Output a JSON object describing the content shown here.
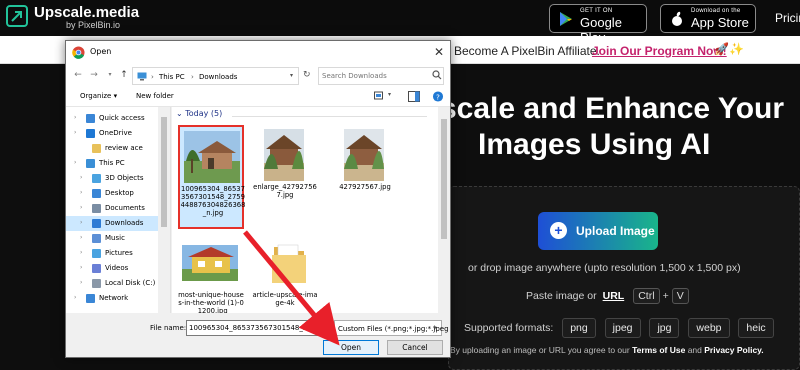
{
  "site": {
    "logo": {
      "title": "Upscale.media",
      "subtitle": "by PixelBin.io"
    },
    "stores": [
      {
        "small": "GET IT ON",
        "big": "Google Play",
        "icon": "google-play-icon"
      },
      {
        "small": "Download on the",
        "big": "App Store",
        "icon": "apple-icon"
      }
    ],
    "nav_pricing": "Pricin",
    "affiliate": {
      "text": "Become A PixelBin Affiliate.",
      "link": "Join Our Program Now!",
      "emoji": "🚀✨"
    },
    "hero": {
      "title_line1": "scale and Enhance Your",
      "title_line2": "Images Using AI",
      "upload_label": "Upload Image",
      "drop_text": "or drop image anywhere (upto resolution 1,500 x 1,500 px)",
      "paste_prefix": "Paste image or",
      "paste_url": "URL",
      "kbd_ctrl": "Ctrl",
      "kbd_plus": "+",
      "kbd_v": "V",
      "formats_label": "Supported formats:",
      "formats": [
        "png",
        "jpeg",
        "jpg",
        "webp",
        "heic"
      ],
      "terms_prefix": "By uploading an image or URL you agree to our",
      "terms_link": "Terms of Use",
      "terms_and": "and",
      "privacy_link": "Privacy Policy."
    }
  },
  "dialog": {
    "title": "Open",
    "close": "✕",
    "breadcrumb": [
      "This PC",
      "Downloads"
    ],
    "search_placeholder": "Search Downloads",
    "organize": "Organize ▾",
    "new_folder": "New folder",
    "sidebar": [
      {
        "label": "Quick access",
        "icon": "star-icon",
        "color": "#3a86d6",
        "chev": "›"
      },
      {
        "label": "OneDrive",
        "icon": "cloud-icon",
        "color": "#1e78d4",
        "chev": "›"
      },
      {
        "label": "review ace",
        "icon": "folder-icon",
        "color": "#e8c15a",
        "chev": ""
      },
      {
        "label": "This PC",
        "icon": "computer-icon",
        "color": "#3a8fd6",
        "chev": "›"
      },
      {
        "label": "3D Objects",
        "icon": "cube-icon",
        "color": "#4aa3e0",
        "chev": "›"
      },
      {
        "label": "Desktop",
        "icon": "desktop-icon",
        "color": "#3a86d6",
        "chev": "›"
      },
      {
        "label": "Documents",
        "icon": "documents-icon",
        "color": "#7a8da3",
        "chev": "›"
      },
      {
        "label": "Downloads",
        "icon": "download-icon",
        "color": "#2e7bd4",
        "chev": "›",
        "selected": true
      },
      {
        "label": "Music",
        "icon": "music-icon",
        "color": "#5b8fd6",
        "chev": "›"
      },
      {
        "label": "Pictures",
        "icon": "pictures-icon",
        "color": "#4aa3e0",
        "chev": "›"
      },
      {
        "label": "Videos",
        "icon": "videos-icon",
        "color": "#6a7fd6",
        "chev": "›"
      },
      {
        "label": "Local Disk (C:)",
        "icon": "disk-icon",
        "color": "#8a98a8",
        "chev": "›"
      },
      {
        "label": "Network",
        "icon": "network-icon",
        "color": "#3a86d6",
        "chev": "›"
      }
    ],
    "group_header": "Today (5)",
    "files": [
      {
        "name": "100965304_865373567301548_2759448876304826368_n.jpg",
        "selected": true
      },
      {
        "name": "enlarge_427927567.jpg",
        "selected": false
      },
      {
        "name": "427927567.jpg",
        "selected": false
      },
      {
        "name": "most-unique-houses-in-the-world (1)-0_1200.jpg",
        "selected": false
      },
      {
        "name": "article-upscale-image-4k",
        "selected": false
      }
    ],
    "filename_label": "File name:",
    "filename_value": "100965304_865373567301548_2759",
    "filetype": "Custom Files (*.png;*.jpg;*.jpeg",
    "open_label": "Open",
    "cancel_label": "Cancel"
  }
}
